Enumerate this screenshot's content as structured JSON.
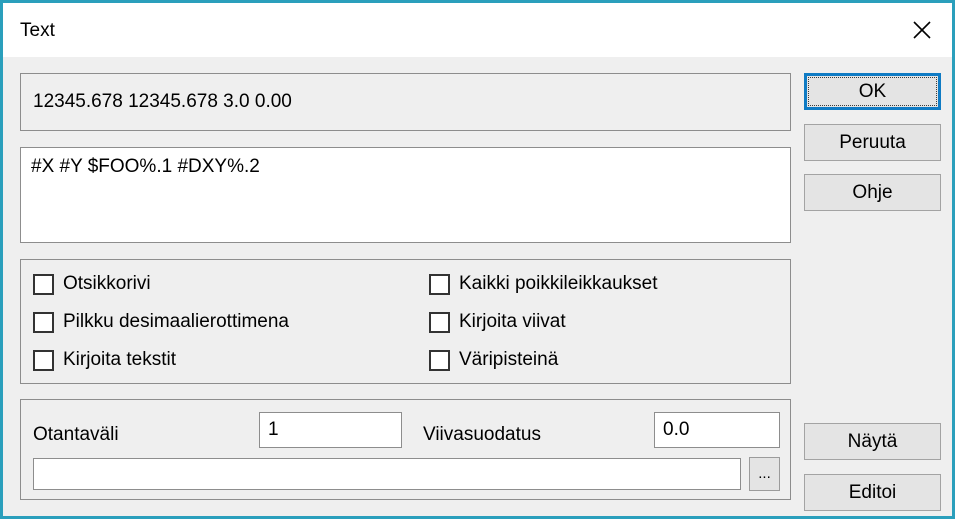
{
  "window": {
    "title": "Text",
    "close_icon": "close-icon",
    "border_color": "#2a9fbc"
  },
  "preview": {
    "value": "12345.678 12345.678 3.0 0.00"
  },
  "format": {
    "value": "#X #Y $FOO%.1 #DXY%.2"
  },
  "checkboxes": {
    "left": [
      {
        "label": "Otsikkorivi",
        "checked": false
      },
      {
        "label": "Pilkku desimaalierottimena",
        "checked": false
      },
      {
        "label": "Kirjoita tekstit",
        "checked": false
      }
    ],
    "right": [
      {
        "label": "Kaikki poikkileikkaukset",
        "checked": false
      },
      {
        "label": "Kirjoita viivat",
        "checked": false
      },
      {
        "label": "Väripisteinä",
        "checked": false
      }
    ]
  },
  "bottom": {
    "sampling_label": "Otantaväli",
    "sampling_value": "1",
    "filter_label": "Viivasuodatus",
    "filter_value": "0.0",
    "path_value": "",
    "browse_label": "..."
  },
  "buttons": {
    "ok": "OK",
    "cancel": "Peruuta",
    "help": "Ohje",
    "show": "Näytä",
    "edit": "Editoi"
  }
}
